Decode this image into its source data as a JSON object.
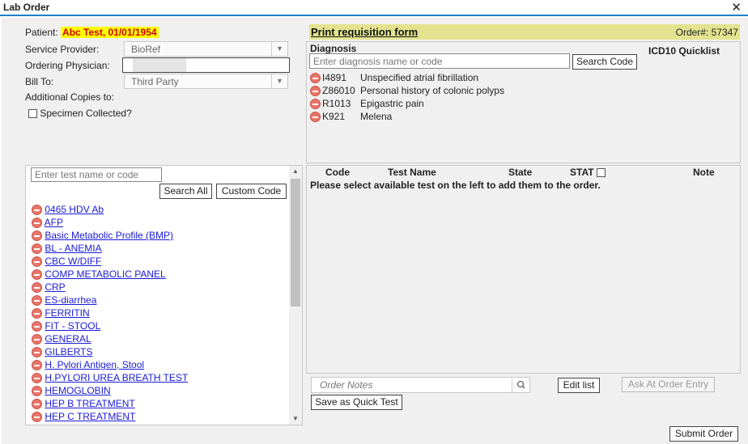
{
  "window": {
    "title": "Lab Order"
  },
  "patient": {
    "label": "Patient:",
    "value": "Abc Test, 01/01/1954"
  },
  "form": {
    "service_provider_label": "Service Provider:",
    "service_provider_value": "BioRef",
    "ordering_physician_label": "Ordering Physician:",
    "bill_to_label": "Bill To:",
    "bill_to_value": "Third Party",
    "additional_copies_label": "Additional Copies to:",
    "specimen_collected_label": "Specimen Collected?"
  },
  "requisition": {
    "print_link": "Print requisition form",
    "order_number": "Order#: 57347"
  },
  "diagnosis": {
    "heading": "Diagnosis",
    "quicklist_label": "ICD10 Quicklist",
    "search_placeholder": "Enter diagnosis name or code",
    "search_button": "Search Code",
    "items": [
      {
        "code": "I4891",
        "description": "Unspecified atrial fibrillation"
      },
      {
        "code": "Z86010",
        "description": "Personal history of colonic polyps"
      },
      {
        "code": "R1013",
        "description": "Epigastric pain"
      },
      {
        "code": "K921",
        "description": "Melena"
      }
    ]
  },
  "test_search": {
    "placeholder": "Enter test name or code",
    "search_all_button": "Search All",
    "custom_code_button": "Custom Code",
    "tests": [
      "0465 HDV Ab",
      "AFP",
      "Basic Metabolic Profile (BMP)",
      "BL - ANEMIA",
      "CBC W/DIFF",
      "COMP METABOLIC PANEL",
      "CRP",
      "ES-diarrhea",
      "FERRITIN",
      "FIT - STOOL",
      "GENERAL",
      "GILBERTS",
      "H. Pylori Antigen, Stool",
      "H.PYLORI UREA BREATH TEST",
      "HEMOGLOBIN",
      "HEP B TREATMENT",
      "HEP C TREATMENT"
    ]
  },
  "order_table": {
    "columns": {
      "code": "Code",
      "test_name": "Test Name",
      "state": "State",
      "stat": "STAT",
      "note": "Note"
    },
    "empty_message": "Please select available test on the left to add them to the order."
  },
  "footer": {
    "order_notes_placeholder": "Order Notes",
    "edit_list_button": "Edit list",
    "ask_at_order_entry_button": "Ask At Order Entry",
    "save_quick_test_button": "Save as Quick Test",
    "submit_order_button": "Submit Order"
  },
  "colors": {
    "accent_line": "#1f7fc4",
    "patient_highlight": "#ffff00",
    "patient_text": "#d00000",
    "requisition_bar": "#e3e38f",
    "link": "#1a1ad8",
    "remove_icon": "#e8756a"
  },
  "icons": {
    "close": "close-icon",
    "remove": "remove-icon",
    "search": "search-icon",
    "dropdown": "chevron-down-icon"
  }
}
